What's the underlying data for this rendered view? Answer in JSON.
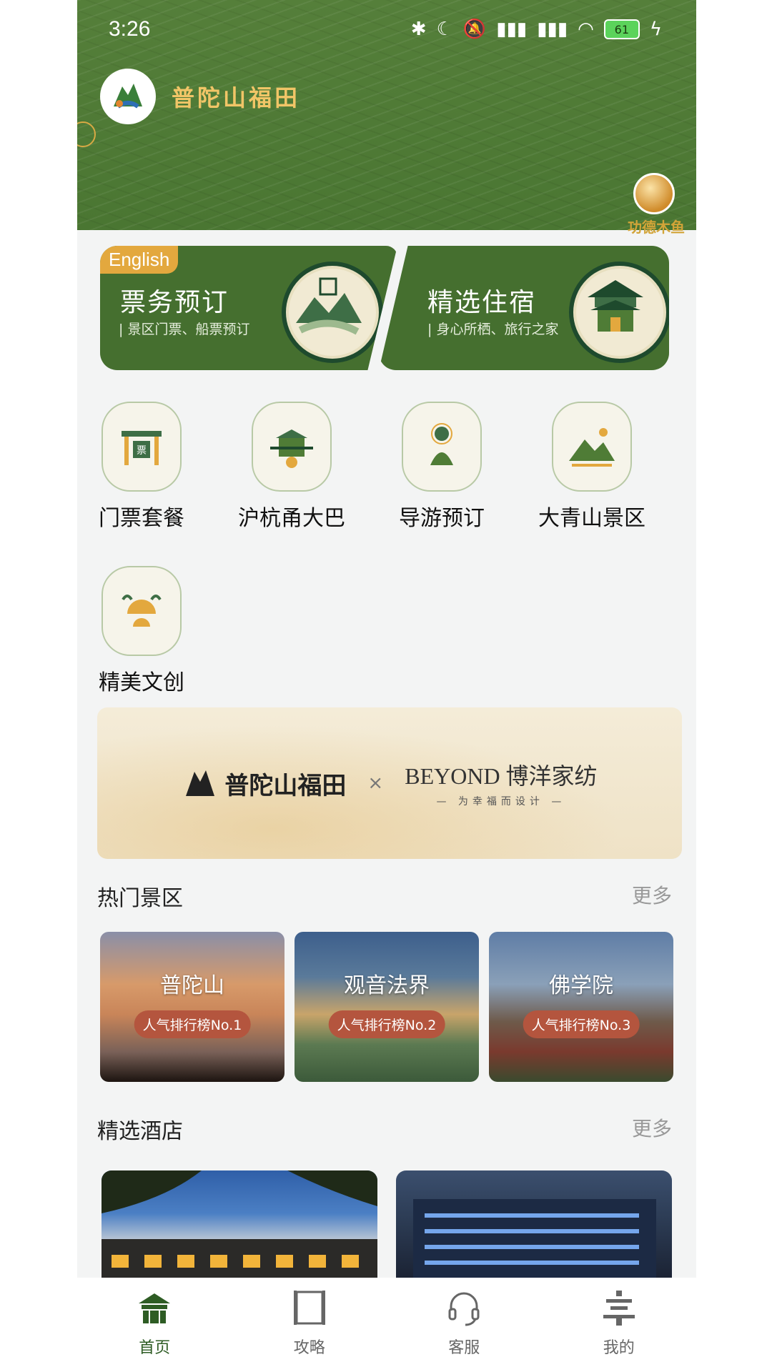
{
  "status_bar": {
    "time": "3:26",
    "battery": "61"
  },
  "header": {
    "brand": "普陀山福田",
    "muyu_label": "功德木鱼"
  },
  "promos": [
    {
      "tag": "English",
      "title": "票务预订",
      "subtitle": "| 景区门票、船票预订"
    },
    {
      "title": "精选住宿",
      "subtitle": "| 身心所栖、旅行之家"
    }
  ],
  "services": [
    {
      "label": "门票套餐"
    },
    {
      "label": "沪杭甬大巴"
    },
    {
      "label": "导游预订"
    },
    {
      "label": "大青山景区"
    },
    {
      "label": "精美文创"
    }
  ],
  "banner": {
    "left": "普陀山福田",
    "right_title": "BEYOND 博洋家纺",
    "right_sub": "— 为幸福而设计 —",
    "times": "×"
  },
  "hot_scenic": {
    "title": "热门景区",
    "more": "更多",
    "items": [
      {
        "name": "普陀山",
        "badge": "人气排行榜No.1"
      },
      {
        "name": "观音法界",
        "badge": "人气排行榜No.2"
      },
      {
        "name": "佛学院",
        "badge": "人气排行榜No.3"
      }
    ]
  },
  "hotels": {
    "title": "精选酒店",
    "more": "更多"
  },
  "tabbar": [
    {
      "label": "首页",
      "icon": "temple-icon",
      "active": true
    },
    {
      "label": "攻略",
      "icon": "scroll-icon",
      "active": false
    },
    {
      "label": "客服",
      "icon": "headset-icon",
      "active": false
    },
    {
      "label": "我的",
      "icon": "profile-icon",
      "active": false
    }
  ],
  "colors": {
    "primary_green": "#4f7c36",
    "accent_gold": "#e3a83e",
    "badge_red": "#b4553e"
  }
}
